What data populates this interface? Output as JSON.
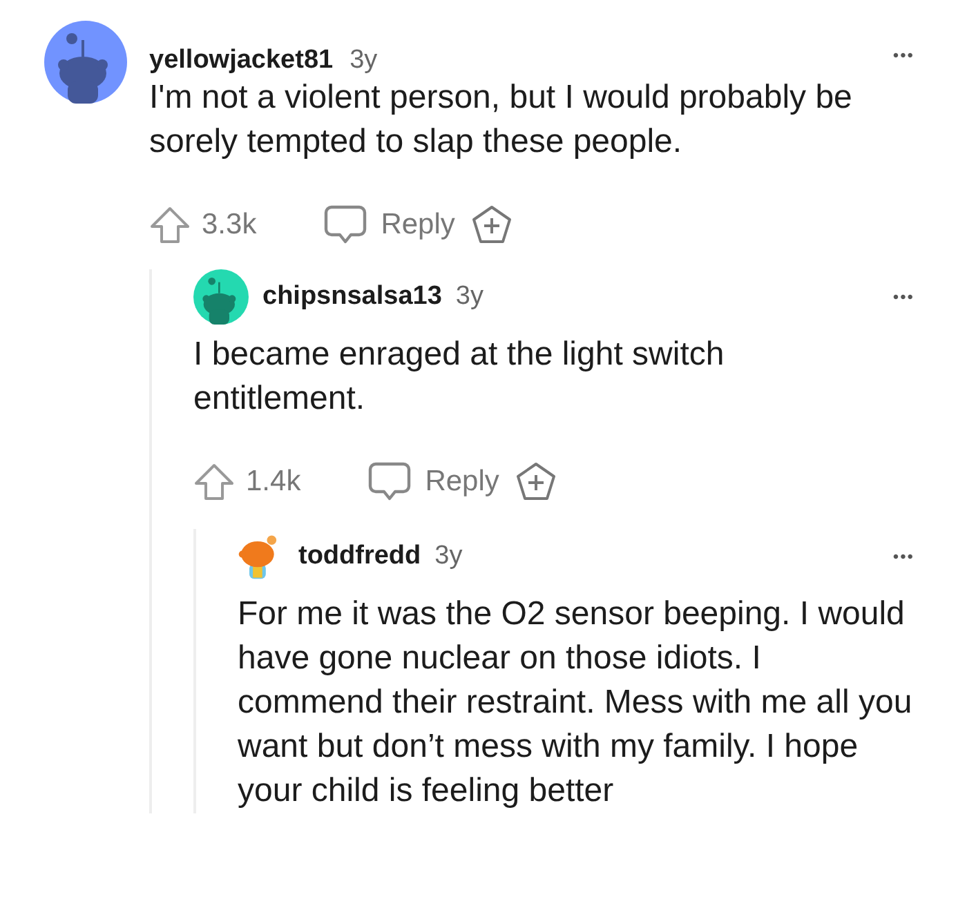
{
  "comments": [
    {
      "avatar": {
        "kind": "snoo",
        "color": "#7193ff"
      },
      "username": "yellowjacket81",
      "age": "3y",
      "more": "•••",
      "body": "I'm not a violent person, but I would probably be sorely tempted to slap these people.",
      "upvotes": "3.3k",
      "reply": "Reply",
      "children": [
        {
          "avatar": {
            "kind": "snoo",
            "color": "#24d9b0"
          },
          "username": "chipsnsalsa13",
          "age": "3y",
          "more": "•••",
          "body": "I became enraged at the light switch entitlement.",
          "upvotes": "1.4k",
          "reply": "Reply",
          "children": [
            {
              "avatar": {
                "kind": "custom"
              },
              "username": "toddfredd",
              "age": "3y",
              "more": "•••",
              "body": "For me it was the O2 sensor beeping. I would have gone nuclear on those idiots. I commend their restraint. Mess with me all you want but don’t mess with my family. I hope your child is feeling better"
            }
          ]
        }
      ]
    }
  ]
}
